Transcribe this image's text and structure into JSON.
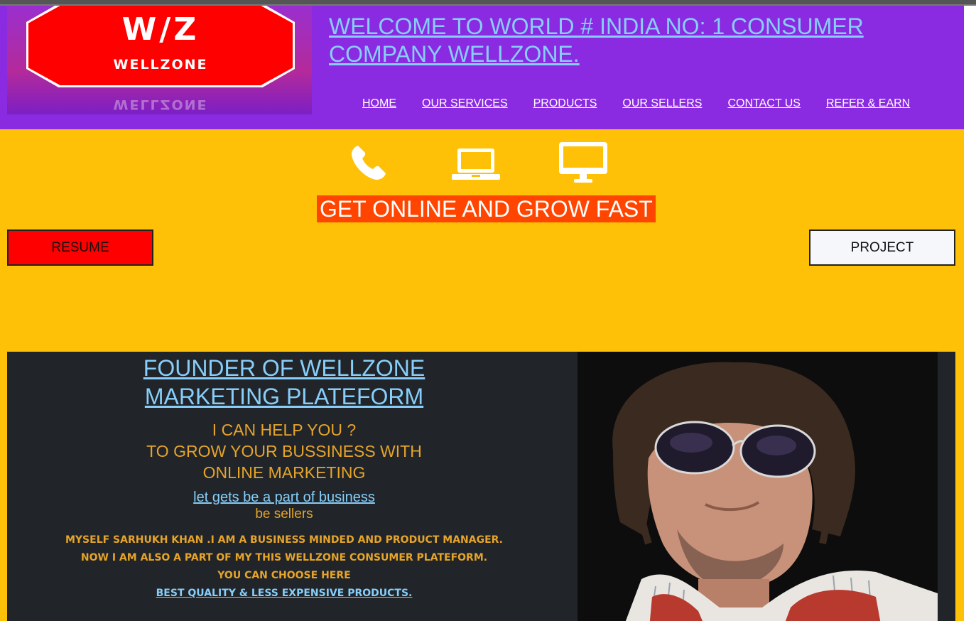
{
  "logo": {
    "main": "W/Z",
    "sub": "WELLZONE",
    "reflection": "WELLZONE"
  },
  "header": {
    "welcome": "WELCOME TO WORLD # INDIA NO: 1 CONSUMER COMPANY WELLZONE.",
    "nav": [
      "HOME",
      "OUR SERVICES",
      "PRODUCTS",
      "OUR SELLERS",
      "CONTACT US",
      "REFER & EARN"
    ]
  },
  "icons": [
    "phone-icon",
    "laptop-icon",
    "desktop-icon"
  ],
  "tagline": "GET ONLINE AND GROW FAST",
  "buttons": {
    "resume": "RESUME",
    "project": "PROJECT"
  },
  "founder": {
    "title_line1": "FOUNDER OF WELLZONE",
    "title_line2": "MARKETING PLATEFORM",
    "help_line1": "I CAN HELP YOU ?",
    "help_line2": "TO GROW YOUR BUSSINESS WITH",
    "help_line3": "ONLINE MARKETING",
    "part_link": "let gets be a part of business",
    "sellers": "be sellers",
    "bio_line1": "MYSELF SARHUKH KHAN .I AM A BUSINESS MINDED AND PRODUCT MANAGER.",
    "bio_line2": "NOW I AM ALSO A PART OF MY THIS WELLZONE CONSUMER PLATEFORM.",
    "bio_line3": "YOU CAN CHOOSE HERE",
    "bio_link": "BEST QUALITY & LESS EXPENSIVE PRODUCTS."
  },
  "colors": {
    "header_bg": "#8a2be2",
    "page_bg": "#ffc107",
    "link": "#87cefa",
    "tagline_bg": "#ff4500",
    "resume_bg": "#ff0000",
    "founder_bg": "#212529",
    "founder_text": "#e6a42a"
  }
}
